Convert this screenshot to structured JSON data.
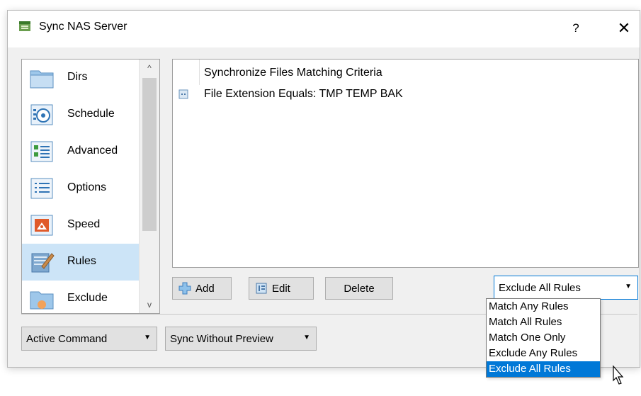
{
  "window": {
    "title": "Sync NAS Server",
    "help": "?",
    "close": "✕"
  },
  "nav": {
    "items": [
      {
        "label": "Dirs",
        "icon": "folder-icon"
      },
      {
        "label": "Schedule",
        "icon": "schedule-icon"
      },
      {
        "label": "Advanced",
        "icon": "advanced-icon"
      },
      {
        "label": "Options",
        "icon": "options-icon"
      },
      {
        "label": "Speed",
        "icon": "speed-icon"
      },
      {
        "label": "Rules",
        "icon": "rules-icon",
        "selected": true
      },
      {
        "label": "Exclude",
        "icon": "exclude-icon"
      }
    ],
    "scroll_up": "^",
    "scroll_down": "v"
  },
  "rules": {
    "header": "Synchronize Files Matching Criteria",
    "items": [
      {
        "text": "File Extension Equals: TMP TEMP BAK",
        "icon": "rule-icon"
      }
    ]
  },
  "buttons": {
    "add": "Add",
    "edit": "Edit",
    "delete": "Delete"
  },
  "rule_mode": {
    "selected": "Exclude All Rules",
    "options": [
      "Match Any Rules",
      "Match All Rules",
      "Match One Only",
      "Exclude Any Rules",
      "Exclude All Rules"
    ]
  },
  "footer": {
    "command": "Active Command",
    "sync_mode": "Sync Without Preview"
  },
  "colors": {
    "selection": "#0078d7",
    "nav_selected": "#cce4f7"
  }
}
